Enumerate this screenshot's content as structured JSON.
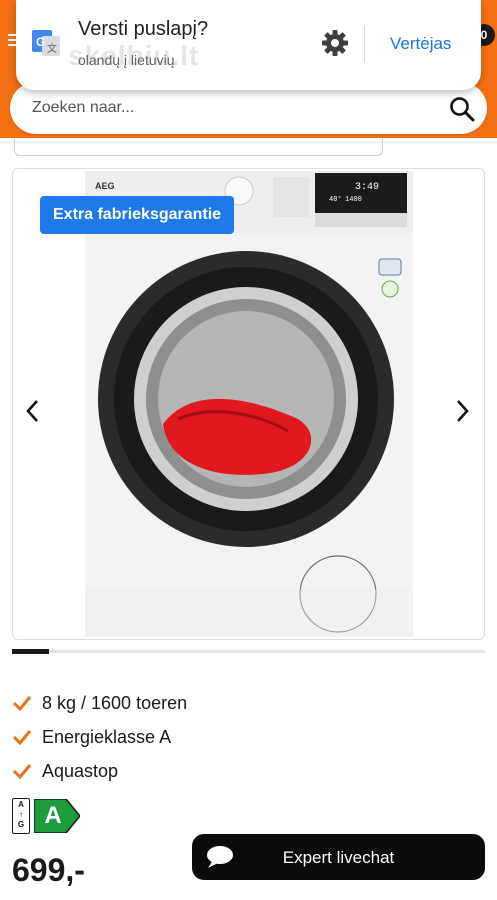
{
  "translate_prompt": {
    "title": "Versti puslapį?",
    "languages": "olandų į lietuvių",
    "translator_button": "Vertėjas",
    "watermark": "skelbiu.lt"
  },
  "header": {
    "cart_count": "0",
    "search": {
      "placeholder": "Zoeken naar..."
    },
    "brand_color": "#f46f12"
  },
  "product": {
    "badge": "Extra fabrieksgarantie",
    "badge_color": "#1f79e8",
    "carousel": {
      "current": 1
    },
    "features": [
      "8 kg / 1600 toeren",
      "Energieklasse A",
      "Aquastop"
    ],
    "check_color": "#e8711a",
    "energy_label": {
      "scale_top": "A",
      "scale_bottom": "G",
      "rating": "A",
      "color": "#1f9b3c"
    },
    "price": "699,-",
    "washer_display": {
      "top": "3:49",
      "temp": "40°",
      "spin": "1400"
    },
    "brand": "AEG"
  },
  "livechat": {
    "label": "Expert livechat"
  }
}
